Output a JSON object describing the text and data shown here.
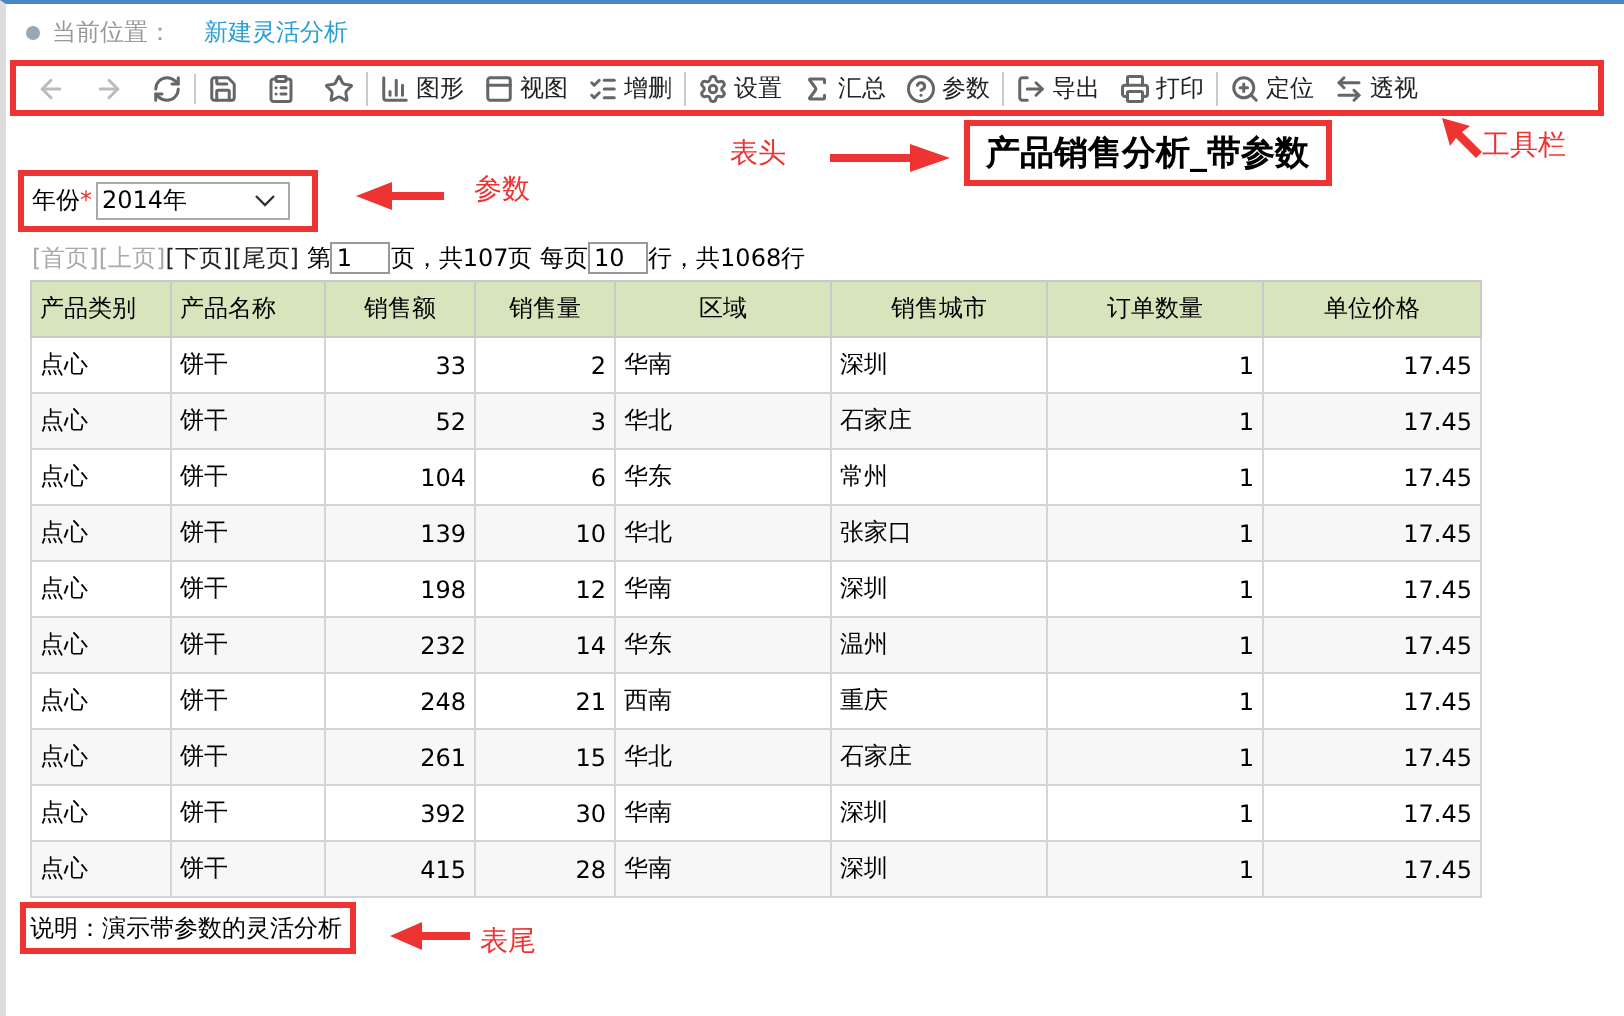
{
  "breadcrumb": {
    "label": "当前位置：",
    "current": "新建灵活分析"
  },
  "toolbar": {
    "groups": [
      [
        {
          "disabled": true
        },
        {
          "disabled": true
        },
        {
          "disabled": false
        }
      ],
      [
        {
          "disabled": false
        },
        {
          "disabled": false
        },
        {
          "disabled": false
        }
      ],
      [
        {
          "label": "图形",
          "disabled": false
        },
        {
          "label": "视图",
          "disabled": false
        },
        {
          "label": "增删",
          "disabled": false
        }
      ],
      [
        {
          "label": "设置",
          "disabled": false
        },
        {
          "label": "汇总",
          "disabled": false
        },
        {
          "label": "参数",
          "disabled": false
        }
      ],
      [
        {
          "label": "导出",
          "disabled": false
        },
        {
          "label": "打印",
          "disabled": false
        }
      ],
      [
        {
          "label": "定位",
          "disabled": false
        },
        {
          "label": "透视",
          "disabled": false
        }
      ]
    ]
  },
  "report_title": "产品销售分析_带参数",
  "parameter": {
    "label": "年份",
    "required_mark": "*",
    "value": "2014年"
  },
  "pagination": {
    "links": [
      {
        "label": "[首页]",
        "disabled": true
      },
      {
        "label": "[上页]",
        "disabled": true
      },
      {
        "label": "[下页]",
        "disabled": false
      },
      {
        "label": "[尾页]",
        "disabled": false
      }
    ],
    "prefix": "第",
    "page": "1",
    "page_suffix": "页，共107页 每页",
    "per_page": "10",
    "total": "行，共1068行"
  },
  "table": {
    "columns": [
      "产品类别",
      "产品名称",
      "销售额",
      "销售量",
      "区域",
      "销售城市",
      "订单数量",
      "单位价格"
    ],
    "rows": [
      [
        "点心",
        "饼干",
        "33",
        "2",
        "华南",
        "深圳",
        "1",
        "17.45"
      ],
      [
        "点心",
        "饼干",
        "52",
        "3",
        "华北",
        "石家庄",
        "1",
        "17.45"
      ],
      [
        "点心",
        "饼干",
        "104",
        "6",
        "华东",
        "常州",
        "1",
        "17.45"
      ],
      [
        "点心",
        "饼干",
        "139",
        "10",
        "华北",
        "张家口",
        "1",
        "17.45"
      ],
      [
        "点心",
        "饼干",
        "198",
        "12",
        "华南",
        "深圳",
        "1",
        "17.45"
      ],
      [
        "点心",
        "饼干",
        "232",
        "14",
        "华东",
        "温州",
        "1",
        "17.45"
      ],
      [
        "点心",
        "饼干",
        "248",
        "21",
        "西南",
        "重庆",
        "1",
        "17.45"
      ],
      [
        "点心",
        "饼干",
        "261",
        "15",
        "华北",
        "石家庄",
        "1",
        "17.45"
      ],
      [
        "点心",
        "饼干",
        "392",
        "30",
        "华南",
        "深圳",
        "1",
        "17.45"
      ],
      [
        "点心",
        "饼干",
        "415",
        "28",
        "华南",
        "深圳",
        "1",
        "17.45"
      ]
    ]
  },
  "footer_note": "说明：演示带参数的灵活分析",
  "annotations": [
    "表头",
    "工具栏",
    "参数",
    "表尾"
  ]
}
